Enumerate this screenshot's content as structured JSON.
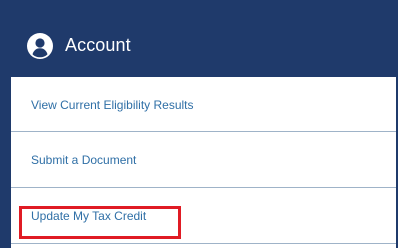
{
  "header": {
    "title": "Account",
    "icon": "user-circle-icon"
  },
  "menu": {
    "items": [
      {
        "label": "View Current Eligibility Results"
      },
      {
        "label": "Submit a Document"
      },
      {
        "label": "Update My Tax Credit"
      }
    ]
  },
  "colors": {
    "header_bg": "#1f3a6b",
    "link": "#2f6fa6",
    "highlight": "#e01b24",
    "divider": "#9fb3c8"
  }
}
